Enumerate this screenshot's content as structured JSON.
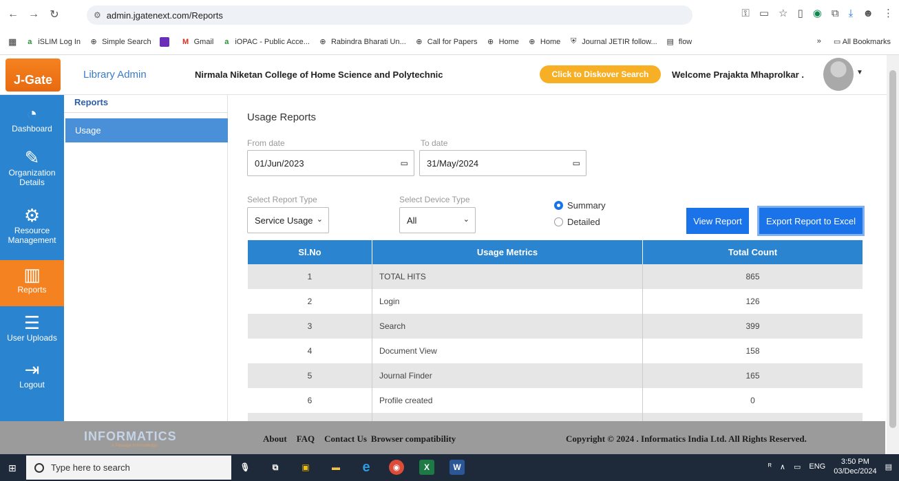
{
  "browser": {
    "url": "admin.jgatenext.com/Reports",
    "bookmarks": [
      {
        "label": "iSLIM Log In",
        "icon": "a-icon"
      },
      {
        "label": "Simple Search",
        "icon": "globe-icon"
      },
      {
        "label": "",
        "icon": "purple-square-icon"
      },
      {
        "label": "Gmail",
        "icon": "gmail-icon"
      },
      {
        "label": "iOPAC - Public Acce...",
        "icon": "a-icon"
      },
      {
        "label": "Rabindra Bharati Un...",
        "icon": "globe-icon"
      },
      {
        "label": "Call for Papers",
        "icon": "globe-icon"
      },
      {
        "label": "Home",
        "icon": "globe-icon"
      },
      {
        "label": "Home",
        "icon": "globe-icon"
      },
      {
        "label": "Journal JETIR follow...",
        "icon": "shield-icon"
      },
      {
        "label": "flow",
        "icon": "doc-icon"
      }
    ],
    "more_label": "»",
    "all_bookmarks": "All Bookmarks"
  },
  "header": {
    "logo": "J-Gate",
    "lib_admin": "Library Admin",
    "college": "Nirmala Niketan College of Home Science and Polytechnic",
    "discover": "Click to Diskover Search",
    "welcome": "Welcome Prajakta Mhaprolkar ."
  },
  "sidebar": {
    "items": [
      {
        "label": "Dashboard",
        "icon": "gauge-icon"
      },
      {
        "label": "Organization Details",
        "icon": "user-pen-icon"
      },
      {
        "label": "Resource Management",
        "icon": "user-gear-icon"
      },
      {
        "label": "Reports",
        "icon": "chart-icon"
      },
      {
        "label": "User Uploads",
        "icon": "upload-list-icon"
      },
      {
        "label": "Logout",
        "icon": "logout-icon"
      }
    ]
  },
  "submenu": {
    "title": "Reports",
    "items": [
      "Usage"
    ]
  },
  "main": {
    "title": "Usage Reports",
    "from_label": "From date",
    "from_value": "01/Jun/2023",
    "to_label": "To date",
    "to_value": "31/May/2024",
    "report_type_label": "Select Report Type",
    "report_type_value": "Service Usage",
    "device_type_label": "Select Device Type",
    "device_type_value": "All",
    "radio_summary": "Summary",
    "radio_detailed": "Detailed",
    "view_report": "View Report",
    "export_excel": "Export Report to Excel",
    "table": {
      "headers": [
        "Sl.No",
        "Usage Metrics",
        "Total Count"
      ],
      "rows": [
        [
          "1",
          "TOTAL HITS",
          "865"
        ],
        [
          "2",
          "Login",
          "126"
        ],
        [
          "3",
          "Search",
          "399"
        ],
        [
          "4",
          "Document View",
          "158"
        ],
        [
          "5",
          "Journal Finder",
          "165"
        ],
        [
          "6",
          "Profile created",
          "0"
        ]
      ]
    }
  },
  "footer": {
    "logo": "INFORMATICS",
    "logo_tagline": "A Passage to Knowledge",
    "links": [
      "About",
      "FAQ",
      "Contact Us",
      "Browser compatibility"
    ],
    "copyright": "Copyright © 2024 . Informatics India Ltd. All Rights Reserved."
  },
  "taskbar": {
    "search_placeholder": "Type here to search",
    "lang": "ENG",
    "time": "3:50 PM",
    "date": "03/Dec/2024"
  }
}
